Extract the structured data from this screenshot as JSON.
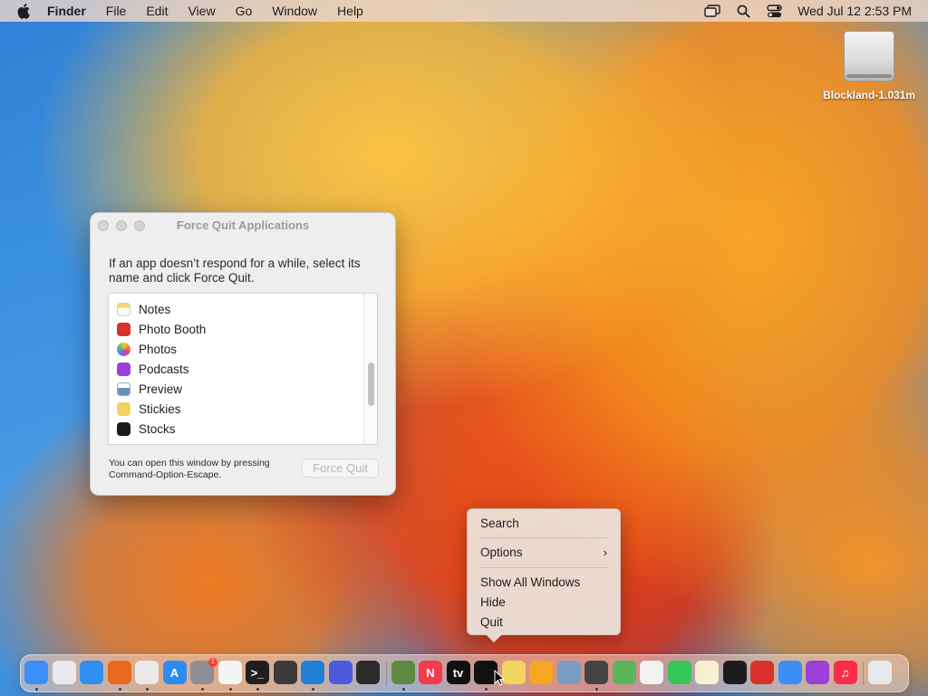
{
  "menubar": {
    "app_name": "Finder",
    "menus": [
      "File",
      "Edit",
      "View",
      "Go",
      "Window",
      "Help"
    ],
    "status_icons": [
      "screen-mirroring-icon",
      "spotlight-search-icon",
      "control-center-icon"
    ],
    "clock": "Wed Jul 12  2:53 PM"
  },
  "desktop": {
    "disk_label": "Blockland-1.031m"
  },
  "force_quit": {
    "title": "Force Quit Applications",
    "description": "If an app doesn’t respond for a while, select its name and click Force Quit.",
    "apps": [
      {
        "name": "Notes",
        "icon": "notes-icon",
        "color": "#f5d76e"
      },
      {
        "name": "Photo Booth",
        "icon": "photo-booth-icon",
        "color": "#d9322b"
      },
      {
        "name": "Photos",
        "icon": "photos-icon",
        "color": "#f28b3b"
      },
      {
        "name": "Podcasts",
        "icon": "podcasts-icon",
        "color": "#9b3fd6"
      },
      {
        "name": "Preview",
        "icon": "preview-icon",
        "color": "#6c8fb8"
      },
      {
        "name": "Stickies",
        "icon": "stickies-icon",
        "color": "#f3d35f"
      },
      {
        "name": "Stocks",
        "icon": "stocks-icon",
        "color": "#1c1c1e"
      }
    ],
    "hint": "You can open this window by pressing Command-Option-Escape.",
    "button_label": "Force Quit"
  },
  "context_menu": {
    "items": [
      {
        "label": "Search"
      },
      {
        "label": "Options",
        "submenu": true,
        "chevron": "›"
      },
      {
        "label": "Show All Windows"
      },
      {
        "label": "Hide"
      },
      {
        "label": "Quit"
      }
    ]
  },
  "dock": {
    "apps": [
      {
        "name": "finder-icon",
        "color": "#3d8ef5",
        "glyph": "",
        "running": true
      },
      {
        "name": "launchpad-icon",
        "color": "#e9e9ee",
        "glyph": "",
        "running": false
      },
      {
        "name": "safari-icon",
        "color": "#2f8ef0",
        "glyph": "",
        "running": false
      },
      {
        "name": "firefox-icon",
        "color": "#e86a1f",
        "glyph": "",
        "running": true
      },
      {
        "name": "chrome-icon",
        "color": "#e9e9e9",
        "glyph": "",
        "running": true
      },
      {
        "name": "app-store-icon",
        "color": "#2d8cf0",
        "glyph": "A",
        "running": false
      },
      {
        "name": "system-settings-icon",
        "color": "#8e8e93",
        "glyph": "",
        "running": true,
        "badge": "1"
      },
      {
        "name": "textedit-icon",
        "color": "#f4f4f4",
        "glyph": "",
        "running": true
      },
      {
        "name": "terminal-icon",
        "color": "#1f1f1f",
        "glyph": ">_",
        "running": true
      },
      {
        "name": "brush-app-icon",
        "color": "#3a3a3a",
        "glyph": "",
        "running": false
      },
      {
        "name": "vscode-icon",
        "color": "#1e7fd4",
        "glyph": "",
        "running": true
      },
      {
        "name": "shortcuts-icon",
        "color": "#4b5bdc",
        "glyph": "",
        "running": false
      },
      {
        "name": "console-icon",
        "color": "#2b2b2b",
        "glyph": "",
        "running": false
      },
      {
        "name": "minecraft-icon",
        "color": "#5c8b3f",
        "glyph": "",
        "running": true
      },
      {
        "name": "news-icon",
        "color": "#f23c4e",
        "glyph": "N",
        "running": false
      },
      {
        "name": "apple-tv-icon",
        "color": "#111111",
        "glyph": "tv",
        "running": false
      },
      {
        "name": "stocks-dock-icon",
        "color": "#111111",
        "glyph": "",
        "running": true
      },
      {
        "name": "stickies-dock-icon",
        "color": "#f3d35f",
        "glyph": "",
        "running": false
      },
      {
        "name": "home-icon",
        "color": "#f5a623",
        "glyph": "",
        "running": false
      },
      {
        "name": "preview-dock-icon",
        "color": "#7a9cc4",
        "glyph": "",
        "running": false
      },
      {
        "name": "photo-booth-grid-icon",
        "color": "#444444",
        "glyph": "",
        "running": true
      },
      {
        "name": "maps-icon",
        "color": "#5bb55a",
        "glyph": "",
        "running": false
      },
      {
        "name": "photos-dock-icon",
        "color": "#f2f2f2",
        "glyph": "",
        "running": false
      },
      {
        "name": "messages-icon",
        "color": "#34c759",
        "glyph": "",
        "running": false
      },
      {
        "name": "notes-dock-icon",
        "color": "#f7f1d2",
        "glyph": "",
        "running": false
      },
      {
        "name": "voice-memos-icon",
        "color": "#1c1c1e",
        "glyph": "",
        "running": false
      },
      {
        "name": "photo-booth-dock-icon",
        "color": "#d9322b",
        "glyph": "",
        "running": false
      },
      {
        "name": "mail-icon",
        "color": "#3b8ef5",
        "glyph": "",
        "running": false
      },
      {
        "name": "podcasts-dock-icon",
        "color": "#9b3fd6",
        "glyph": "",
        "running": false
      },
      {
        "name": "music-icon",
        "color": "#fa2d48",
        "glyph": "♫",
        "running": false
      },
      {
        "name": "trash-icon",
        "color": "#e8e8ea",
        "glyph": "",
        "running": false
      }
    ]
  }
}
